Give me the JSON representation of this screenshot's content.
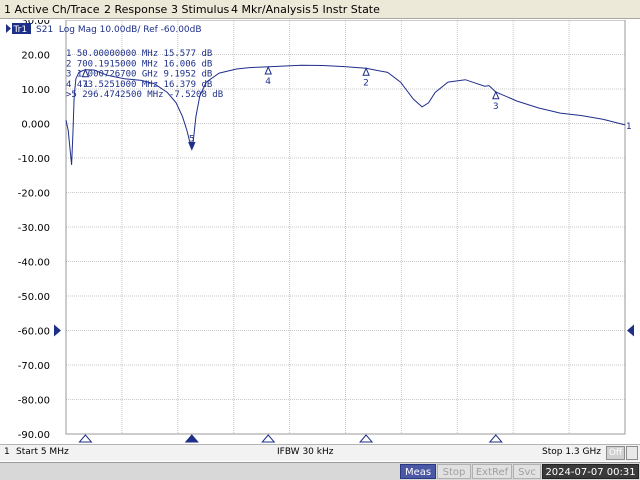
{
  "menu": {
    "items": [
      "1 Active Ch/Trace",
      "2 Response",
      "3 Stimulus",
      "4 Mkr/Analysis",
      "5 Instr State"
    ]
  },
  "trace": {
    "badge": "Tr1",
    "header": "S21  Log Mag 10.00dB/ Ref -60.00dB",
    "color": "#1e2f8a",
    "ref_color": "#1e2f8a"
  },
  "markers": [
    {
      "id": "1",
      "prefix": "",
      "readout": "  1   50.00000000 MHz  15.577 dB",
      "freq_mhz": 50.0,
      "value_db": 15.577
    },
    {
      "id": "2",
      "prefix": "",
      "readout": "  2   700.1915000 MHz  16.006 dB",
      "freq_mhz": 700.1915,
      "value_db": 16.006
    },
    {
      "id": "3",
      "prefix": "",
      "readout": "  3   1.000726700 GHz  9.1952 dB",
      "freq_mhz": 1000.7267,
      "value_db": 9.1952
    },
    {
      "id": "4",
      "prefix": "",
      "readout": "  4   473.5251000 MHz  16.379 dB",
      "freq_mhz": 473.5251,
      "value_db": 16.379
    },
    {
      "id": "5",
      "prefix": ">",
      "readout": ">5   296.4742500 MHz -7.5208 dB",
      "freq_mhz": 296.47425,
      "value_db": -7.5208
    }
  ],
  "chart_data": {
    "type": "line",
    "ylim": [
      -90,
      30
    ],
    "xlim_mhz": [
      5,
      1300
    ],
    "y_ticks": [
      "30.00",
      "20.00",
      "10.00",
      "0.000",
      "-10.00",
      "-20.00",
      "-30.00",
      "-40.00",
      "-50.00",
      "-60.00",
      "-70.00",
      "-80.00",
      "-90.00"
    ],
    "x_divisions": 10,
    "reference_level_db": -60,
    "grid": true,
    "series": [
      {
        "x_mhz": [
          5,
          10,
          14,
          18,
          21,
          24,
          28,
          35,
          45,
          50,
          70,
          100,
          140,
          180,
          210,
          240,
          260,
          275,
          285,
          292,
          296.5,
          300,
          306,
          315,
          330,
          360,
          400,
          430,
          470,
          500,
          550,
          600,
          650,
          700,
          750,
          780,
          810,
          830,
          845,
          860,
          890,
          930,
          975,
          985,
          990,
          1000,
          1050,
          1100,
          1150,
          1200,
          1250,
          1300
        ],
        "y_db": [
          1,
          -2,
          -7,
          -12,
          -3,
          8,
          13,
          14.8,
          15.4,
          15.6,
          15.5,
          14,
          13,
          12.5,
          11.5,
          9,
          6,
          2,
          -2,
          -5.5,
          -7.5,
          -5,
          2,
          8,
          12,
          14.6,
          15.8,
          16.2,
          16.4,
          16.6,
          16.9,
          16.8,
          16.5,
          16.0,
          14.8,
          12,
          7,
          4.8,
          6,
          9,
          12,
          12.7,
          10.8,
          11,
          10.4,
          9.2,
          6.5,
          4.5,
          3,
          2.3,
          1.2,
          -0.4
        ]
      }
    ]
  },
  "status": {
    "channel": "1",
    "start": "Start 5 MHz",
    "ifbw": "IFBW 30 kHz",
    "stop": "Stop 1.3 GHz",
    "off": "Off",
    "meas": "Meas",
    "stop_btn": "Stop",
    "extref": "ExtRef",
    "svc": "Svc",
    "clock": "2024-07-07 00:31"
  }
}
